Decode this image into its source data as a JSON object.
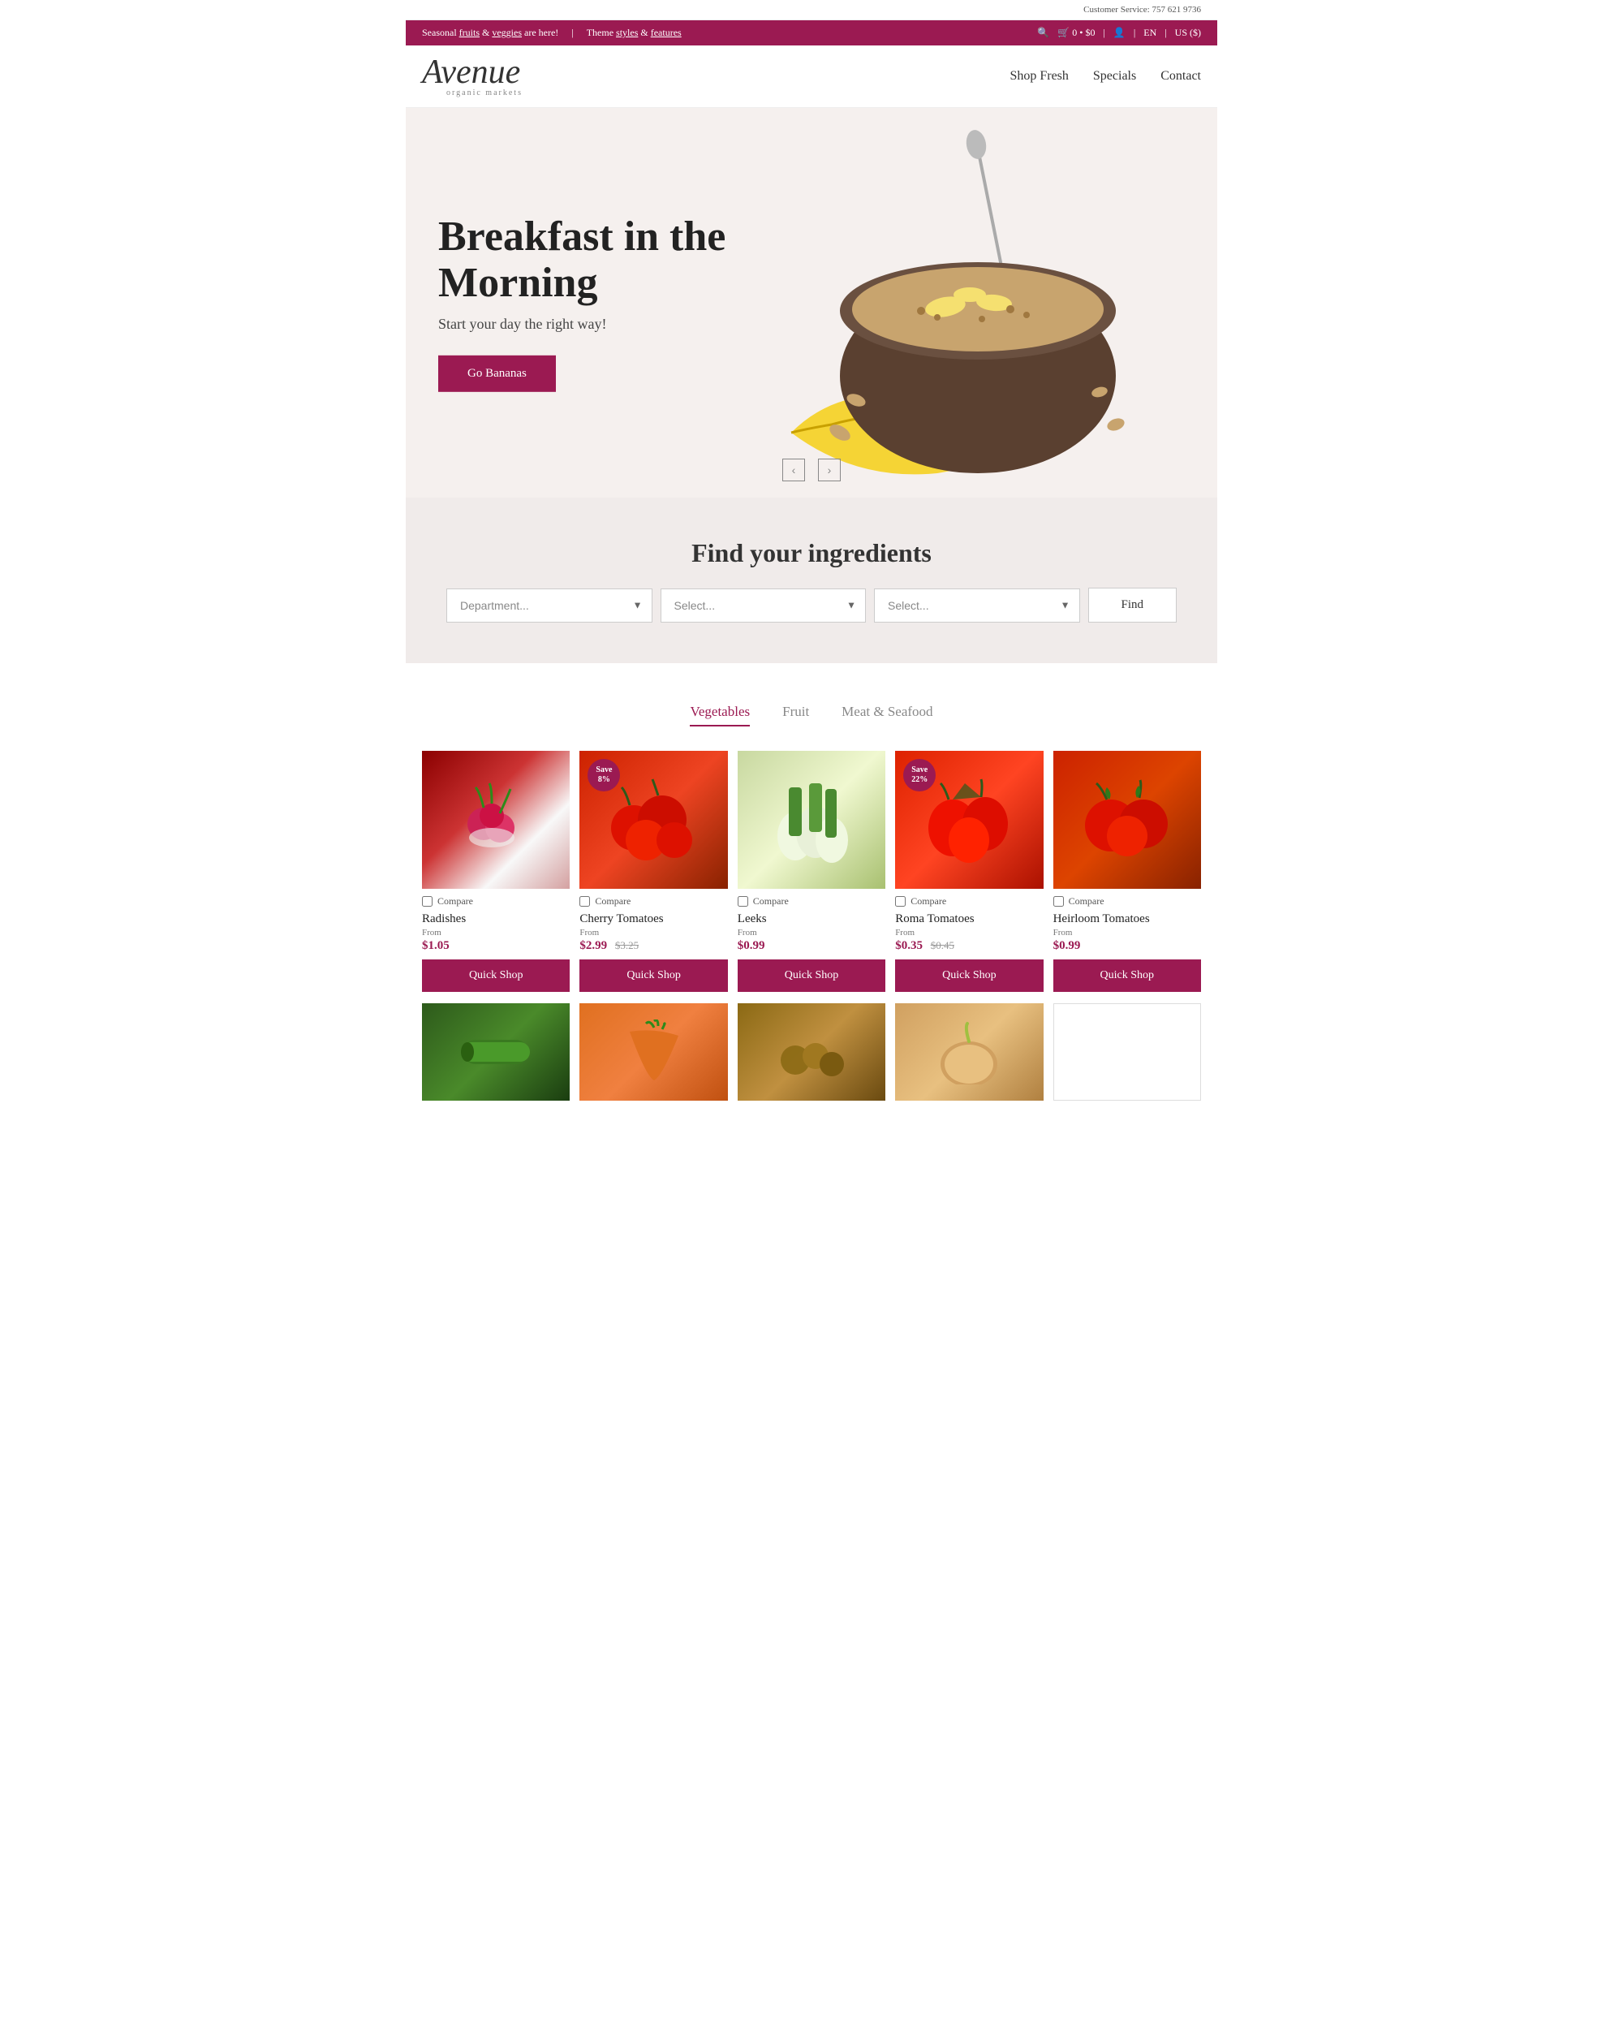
{
  "customer_service": {
    "label": "Customer Service: 757 621 9736"
  },
  "announcement": {
    "text_before": "Seasonal ",
    "link1": "fruits",
    "text_middle": " & ",
    "link2": "veggies",
    "text_after": " are here!",
    "separator": "|",
    "theme_text": "Theme ",
    "link3": "styles",
    "text_and": " & ",
    "link4": "features"
  },
  "nav_icons": {
    "search": "🔍",
    "cart": "🛒",
    "cart_count": "0",
    "cart_price": "$0",
    "user": "👤",
    "lang": "EN",
    "currency": "US ($)"
  },
  "logo": {
    "main": "Avenue",
    "sub": "organic markets"
  },
  "nav": {
    "items": [
      {
        "label": "Shop Fresh",
        "href": "#"
      },
      {
        "label": "Specials",
        "href": "#"
      },
      {
        "label": "Contact",
        "href": "#"
      }
    ]
  },
  "hero": {
    "heading_line1": "Breakfast in the",
    "heading_line2": "Morning",
    "subheading": "Start your day the right way!",
    "button_label": "Go Bananas"
  },
  "find_section": {
    "title": "Find your ingredients",
    "select1_placeholder": "Department...",
    "select2_placeholder": "Select...",
    "select3_placeholder": "Select...",
    "button_label": "Find"
  },
  "tabs": [
    {
      "label": "Vegetables",
      "active": true
    },
    {
      "label": "Fruit",
      "active": false
    },
    {
      "label": "Meat & Seafood",
      "active": false
    }
  ],
  "products": [
    {
      "name": "Radishes",
      "from_label": "From",
      "price": "$1.05",
      "original_price": null,
      "save_badge": null,
      "quick_shop": "Quick Shop",
      "compare_label": "Compare",
      "img_class": "img-radishes"
    },
    {
      "name": "Cherry Tomatoes",
      "from_label": "From",
      "price": "$2.99",
      "original_price": "$3.25",
      "save_badge": "Save\n8%",
      "quick_shop": "Quick Shop",
      "compare_label": "Compare",
      "img_class": "img-cherry-tomatoes"
    },
    {
      "name": "Leeks",
      "from_label": "From",
      "price": "$0.99",
      "original_price": null,
      "save_badge": null,
      "quick_shop": "Quick Shop",
      "compare_label": "Compare",
      "img_class": "img-leeks"
    },
    {
      "name": "Roma Tomatoes",
      "from_label": "From",
      "price": "$0.35",
      "original_price": "$0.45",
      "save_badge": "Save\n22%",
      "quick_shop": "Quick Shop",
      "compare_label": "Compare",
      "img_class": "img-roma-tomatoes"
    },
    {
      "name": "Heirloom Tomatoes",
      "from_label": "From",
      "price": "$0.99",
      "original_price": null,
      "save_badge": null,
      "quick_shop": "Quick Shop",
      "compare_label": "Compare",
      "img_class": "img-heirloom-tomatoes"
    }
  ],
  "products_row2": [
    {
      "img_class": "img-zucchini"
    },
    {
      "img_class": "img-carrot"
    },
    {
      "img_class": "img-mixed-veg"
    },
    {
      "img_class": "img-onion"
    },
    {
      "img_class": "img-white"
    }
  ]
}
